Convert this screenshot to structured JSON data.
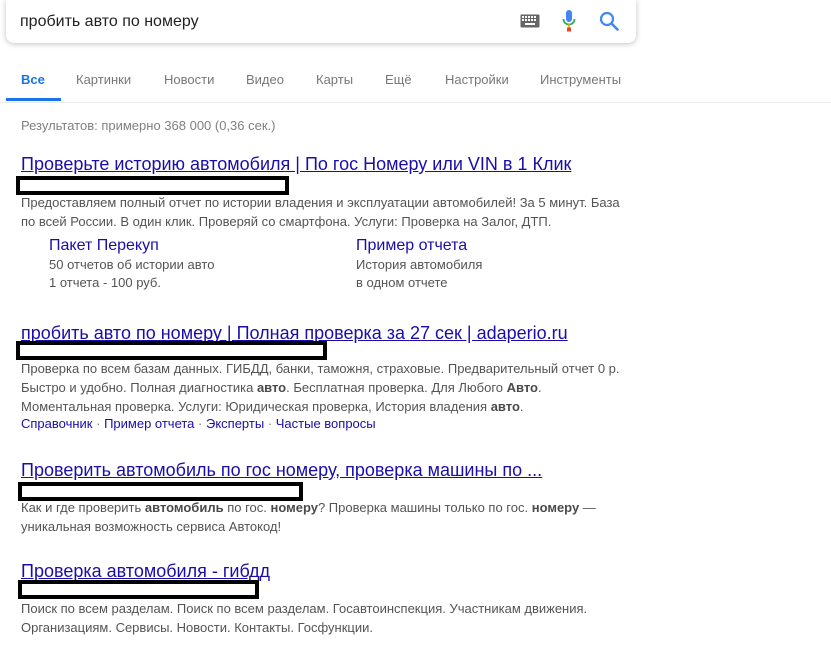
{
  "search": {
    "query": "пробить авто по номеру"
  },
  "icons": {
    "keyboard": "keyboard-icon",
    "mic": "microphone-icon",
    "search": "search-icon"
  },
  "tabs": [
    {
      "label": "Все",
      "active": true
    },
    {
      "label": "Картинки"
    },
    {
      "label": "Новости"
    },
    {
      "label": "Видео"
    },
    {
      "label": "Карты"
    },
    {
      "label": "Ещё"
    },
    {
      "label": "Настройки"
    },
    {
      "label": "Инструменты"
    }
  ],
  "stats": "Результатов: примерно 368 000 (0,36 сек.)",
  "results": [
    {
      "title": "Проверьте историю автомобиля | По гос Номеру или VIN в 1 Клик",
      "snippet_lines": [
        "Предоставляем полный отчет по истории владения и эксплуатации автомобилей! За 5 минут. База",
        "по всей России. В один клик. Проверяй со смартфона. Услуги: Проверка на Залог, ДТП."
      ],
      "sitelinks": [
        {
          "title": "Пакет Перекуп",
          "lines": [
            "50 отчетов об истории авто",
            "1 отчета - 100 руб."
          ]
        },
        {
          "title": "Пример отчета",
          "lines": [
            "История автомобиля",
            "в одном отчете"
          ]
        }
      ]
    },
    {
      "title": "пробить авто по номеру | Полная проверка за 27 сек | adaperio.ru",
      "snippet": {
        "l1": "Проверка по всем базам данных. ГИБДД, банки, таможня, страховые. Предварительный отчет 0 р.",
        "l2a": "Быстро и удобно. Полная диагностика ",
        "l2b": "авто",
        "l2c": ". Бесплатная проверка. Для Любого ",
        "l2d": "Авто",
        "l2e": ".",
        "l3a": "Моментальная проверка. Услуги: Юридическая проверка, История владения ",
        "l3b": "авто",
        "l3c": "."
      },
      "inline_links": [
        "Справочник",
        "Пример отчета",
        "Эксперты",
        "Частые вопросы"
      ],
      "separator": " · "
    },
    {
      "title": "Проверить автомобиль по гос номеру, проверка машины по ...",
      "snippet": {
        "l1a": "Как и где проверить ",
        "l1b": "автомобиль",
        "l1c": " по гос. ",
        "l1d": "номеру",
        "l1e": "? Проверка машины только по гос. ",
        "l1f": "номеру",
        "l1g": " —",
        "l2": "уникальная возможность сервиса Автокод!"
      }
    },
    {
      "title": "Проверка автомобиля - гибдд",
      "snippet_lines": [
        "Поиск по всем разделам. Поиск по всем разделам. Госавтоинспекция. Участникам движения.",
        "Организациям. Сервисы. Новости. Контакты. Госфункции."
      ]
    }
  ],
  "colors": {
    "link": "#1a0dab",
    "accent": "#1a73e8",
    "snippet": "#545454"
  }
}
